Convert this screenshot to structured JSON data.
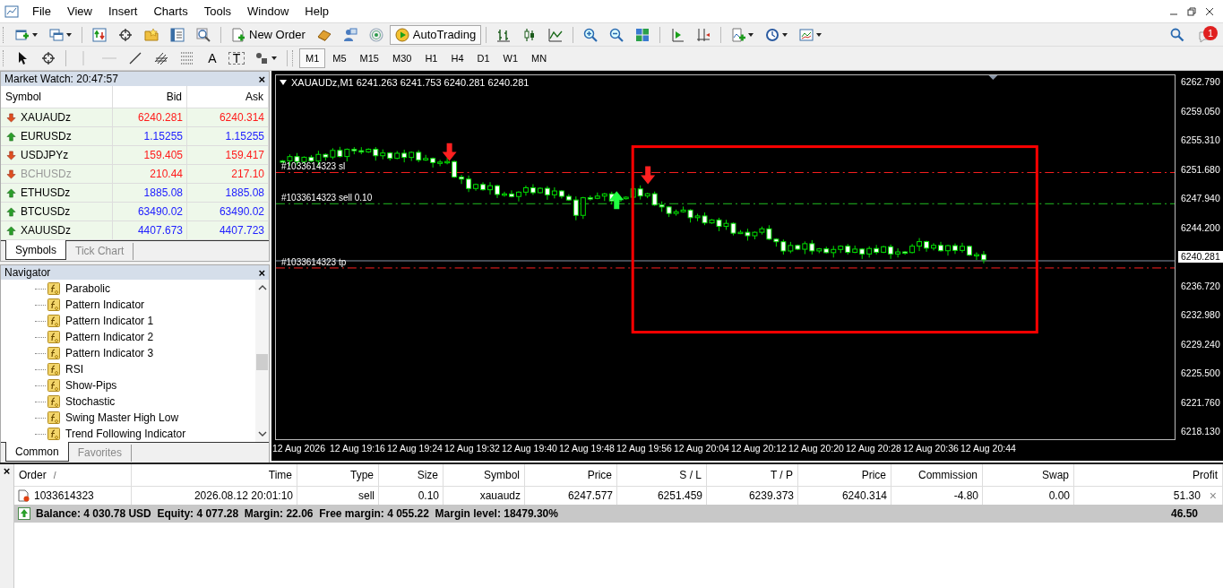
{
  "menu": [
    {
      "label": "File"
    },
    {
      "label": "View"
    },
    {
      "label": "Insert"
    },
    {
      "label": "Charts"
    },
    {
      "label": "Tools"
    },
    {
      "label": "Window"
    },
    {
      "label": "Help"
    }
  ],
  "toolbar": {
    "new_order": "New Order",
    "autotrading": {
      "label": "AutoTrading",
      "on": true
    },
    "text_tool": "A",
    "label_tool": "T",
    "notifications": "1"
  },
  "timeframes": [
    {
      "label": "M1",
      "selected": true
    },
    {
      "label": "M5",
      "selected": false
    },
    {
      "label": "M15",
      "selected": false
    },
    {
      "label": "M30",
      "selected": false
    },
    {
      "label": "H1",
      "selected": false
    },
    {
      "label": "H4",
      "selected": false
    },
    {
      "label": "D1",
      "selected": false
    },
    {
      "label": "W1",
      "selected": false
    },
    {
      "label": "MN",
      "selected": false
    }
  ],
  "market_watch": {
    "title": "Market Watch: 20:47:57",
    "close": "×",
    "columns": [
      "Symbol",
      "Bid",
      "Ask"
    ],
    "rows": [
      {
        "symbol": "XAUAUDz",
        "bid": "6240.281",
        "ask": "6240.314",
        "rising": false,
        "disabled": false
      },
      {
        "symbol": "EURUSDz",
        "bid": "1.15255",
        "ask": "1.15255",
        "rising": true,
        "disabled": false
      },
      {
        "symbol": "USDJPYz",
        "bid": "159.405",
        "ask": "159.417",
        "rising": false,
        "disabled": false
      },
      {
        "symbol": "BCHUSDz",
        "bid": "210.44",
        "ask": "217.10",
        "rising": false,
        "disabled": true
      },
      {
        "symbol": "ETHUSDz",
        "bid": "1885.08",
        "ask": "1885.08",
        "rising": true,
        "disabled": false
      },
      {
        "symbol": "BTCUSDz",
        "bid": "63490.02",
        "ask": "63490.02",
        "rising": true,
        "disabled": false
      },
      {
        "symbol": "XAUUSDz",
        "bid": "4407.673",
        "ask": "4407.723",
        "rising": true,
        "disabled": false
      }
    ],
    "tabs": [
      {
        "label": "Symbols",
        "selected": true
      },
      {
        "label": "Tick Chart",
        "selected": false
      }
    ]
  },
  "navigator": {
    "title": "Navigator",
    "close": "×",
    "items": [
      "Parabolic",
      "Pattern Indicator",
      "Pattern Indicator 1",
      "Pattern Indicator 2",
      "Pattern Indicator 3",
      "RSI",
      "Show-Pips",
      "Stochastic",
      "Swing Master High Low",
      "Trend Following Indicator"
    ],
    "tabs": [
      {
        "label": "Common",
        "selected": true
      },
      {
        "label": "Favorites",
        "selected": false
      }
    ]
  },
  "chart": {
    "header": "XAUAUDz,M1  6241.263 6241.753 6240.281 6240.281",
    "order_lines": [
      {
        "kind": "sl",
        "label": "#1033614323 sl"
      },
      {
        "kind": "entry",
        "label": "#1033614323 sell 0.10"
      },
      {
        "kind": "tp",
        "label": "#1033614323 tp"
      }
    ],
    "current_price": "6240.281",
    "price_axis": [
      "6262.790",
      "6259.050",
      "6255.310",
      "6251.680",
      "6247.940",
      "6244.200",
      "6236.720",
      "6232.980",
      "6229.240",
      "6225.500",
      "6221.760",
      "6218.130"
    ],
    "time_axis": [
      "12 Aug 2026",
      "12 Aug 19:16",
      "12 Aug 19:24",
      "12 Aug 19:32",
      "12 Aug 19:40",
      "12 Aug 19:48",
      "12 Aug 19:56",
      "12 Aug 20:04",
      "12 Aug 20:12",
      "12 Aug 20:20",
      "12 Aug 20:28",
      "12 Aug 20:36",
      "12 Aug 20:44"
    ]
  },
  "terminal": {
    "close": "×",
    "columns": [
      {
        "label": "Order",
        "sort": "/"
      },
      {
        "label": "Time"
      },
      {
        "label": "Type"
      },
      {
        "label": "Size"
      },
      {
        "label": "Symbol"
      },
      {
        "label": "Price"
      },
      {
        "label": "S / L"
      },
      {
        "label": "T / P"
      },
      {
        "label": "Price"
      },
      {
        "label": "Commission"
      },
      {
        "label": "Swap"
      },
      {
        "label": "Profit"
      }
    ],
    "orders": [
      {
        "cells": [
          "1033614323",
          "2026.08.12 20:01:10",
          "sell",
          "0.10",
          "xauaudz",
          "6247.577",
          "6251.459",
          "6239.373",
          "6240.314",
          "-4.80",
          "0.00",
          "51.30"
        ],
        "close": "×"
      }
    ],
    "summary": {
      "text": "Balance: 4 030.78 USD  Equity: 4 077.28  Margin: 22.06  Free margin: 4 055.22  Margin level: 18479.30%",
      "total": "46.50"
    }
  }
}
